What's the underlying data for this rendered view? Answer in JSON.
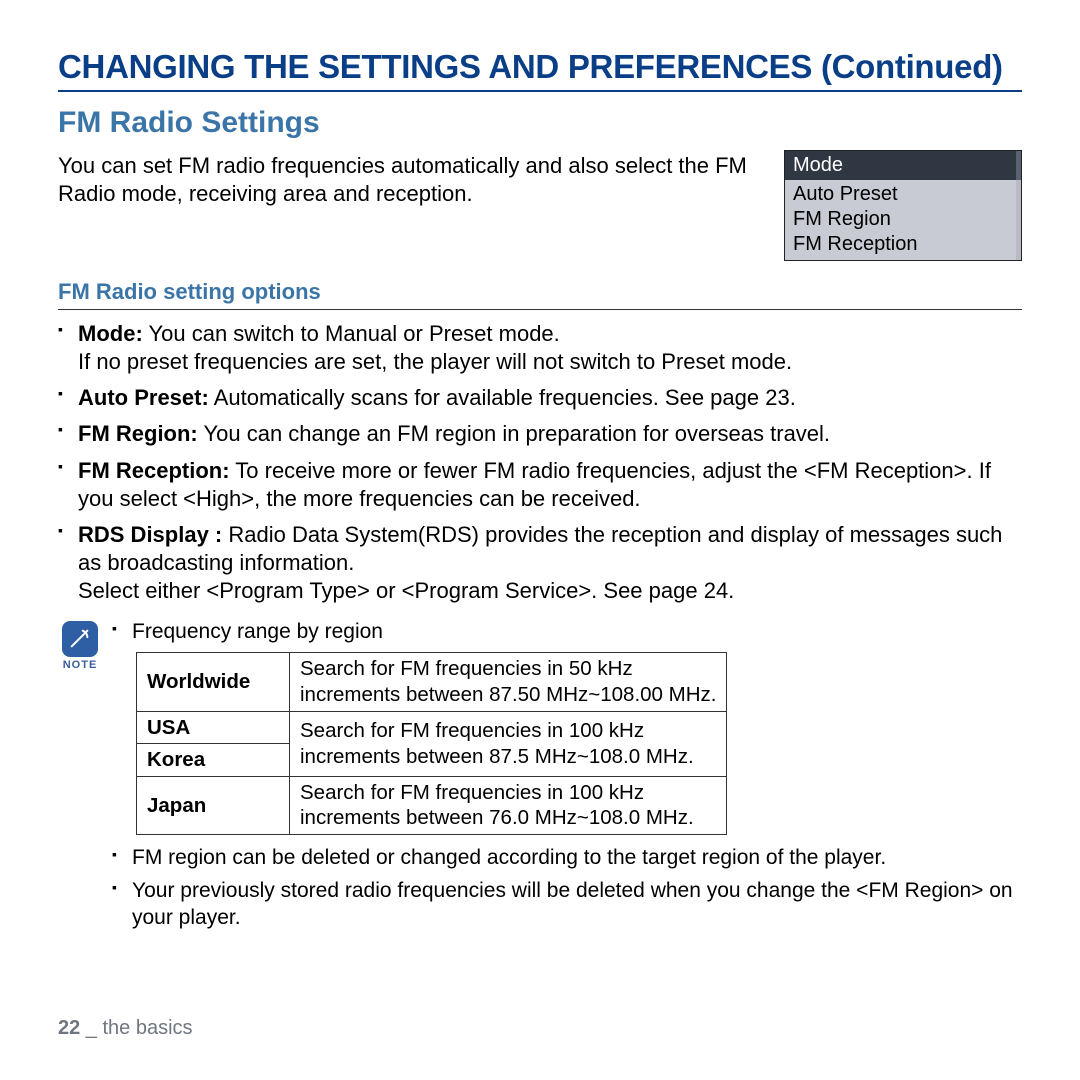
{
  "main_title": "CHANGING THE SETTINGS AND PREFERENCES (Continued)",
  "section_title": "FM Radio Settings",
  "intro_text": "You can set FM radio frequencies automatically and also select the FM Radio mode, receiving area and reception.",
  "menu": {
    "active": "Mode",
    "items": [
      "Auto Preset",
      "FM Region",
      "FM Reception"
    ]
  },
  "sub_title": "FM Radio setting options",
  "options": [
    {
      "label": "Mode:",
      "text": " You can switch to Manual or Preset mode.",
      "extra": "If no preset frequencies are set, the player will not switch to Preset mode."
    },
    {
      "label": "Auto Preset:",
      "text": " Automatically scans for available frequencies. See page 23."
    },
    {
      "label": "FM Region:",
      "text": " You can change an FM region in preparation for overseas travel."
    },
    {
      "label": "FM Reception:",
      "text": " To receive more or fewer FM radio frequencies, adjust the <FM Reception>. If you select <High>, the more frequencies can be received."
    },
    {
      "label": "RDS Display :",
      "text": " Radio Data System(RDS) provides the reception and display of messages such as broadcasting information.",
      "extra": "Select either <Program Type> or <Program Service>. See page 24."
    }
  ],
  "note": {
    "caption": "NOTE",
    "freq_title": "Frequency range by region",
    "table": [
      {
        "region": "Worldwide",
        "l1": "Search for FM frequencies in 50 kHz",
        "l2": "increments between 87.50 MHz~108.00 MHz."
      },
      {
        "region": "USA",
        "l1": "Search for FM frequencies in 100 kHz",
        "l2": "increments between 87.5 MHz~108.0 MHz."
      },
      {
        "region": "Korea"
      },
      {
        "region": "Japan",
        "l1": "Search for FM frequencies in 100 kHz",
        "l2": "increments between 76.0 MHz~108.0 MHz."
      }
    ],
    "bullets_after": [
      "FM region can be deleted or changed according to the target region of the player.",
      "Your previously stored radio frequencies will be deleted when you change the <FM Region> on your player."
    ]
  },
  "footer": {
    "page": "22",
    "sep": " _ ",
    "section": "the basics"
  }
}
